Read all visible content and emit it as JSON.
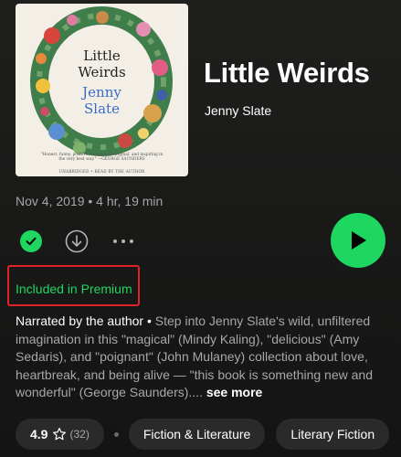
{
  "book": {
    "title": "Little Weirds",
    "author": "Jenny Slate",
    "meta": "Nov 4, 2019 • 4 hr, 19 min"
  },
  "cover": {
    "title_line1": "Little",
    "title_line2": "Weirds",
    "author_line1": "Jenny",
    "author_line2": "Slate",
    "blurb": "\"Honest, funny, positive, completely original, and inspiring in the very best way.\" —GEORGE SAUNDERS",
    "footer": "UNABRIDGED • READ BY THE AUTHOR"
  },
  "actions": {
    "saved_icon": "check-circle-icon",
    "download_icon": "download-icon",
    "more_icon": "more-horizontal-icon",
    "play_icon": "play-icon"
  },
  "premium": {
    "label": "Included in Premium"
  },
  "description": {
    "lead": "Narrated by the author",
    "separator": " • ",
    "body": "Step into Jenny Slate's wild, unfiltered imagination in this \"magical\" (Mindy Kaling), \"delicious\" (Amy Sedaris), and \"poignant\" (John Mulaney) collection about love, heartbreak, and being alive — \"this book is something new and wonderful\" (George Saunders)....",
    "see_more": "see more"
  },
  "chips": {
    "rating_value": "4.9",
    "rating_icon": "star-outline-icon",
    "rating_count": "(32)",
    "genre1": "Fiction & Literature",
    "genre2": "Literary Fiction"
  },
  "colors": {
    "accent": "#1ed760",
    "highlight_box": "#e0232b",
    "background": "#1a1a19",
    "chip_bg": "#2a2a2a",
    "muted_text": "#a7a7a7"
  }
}
